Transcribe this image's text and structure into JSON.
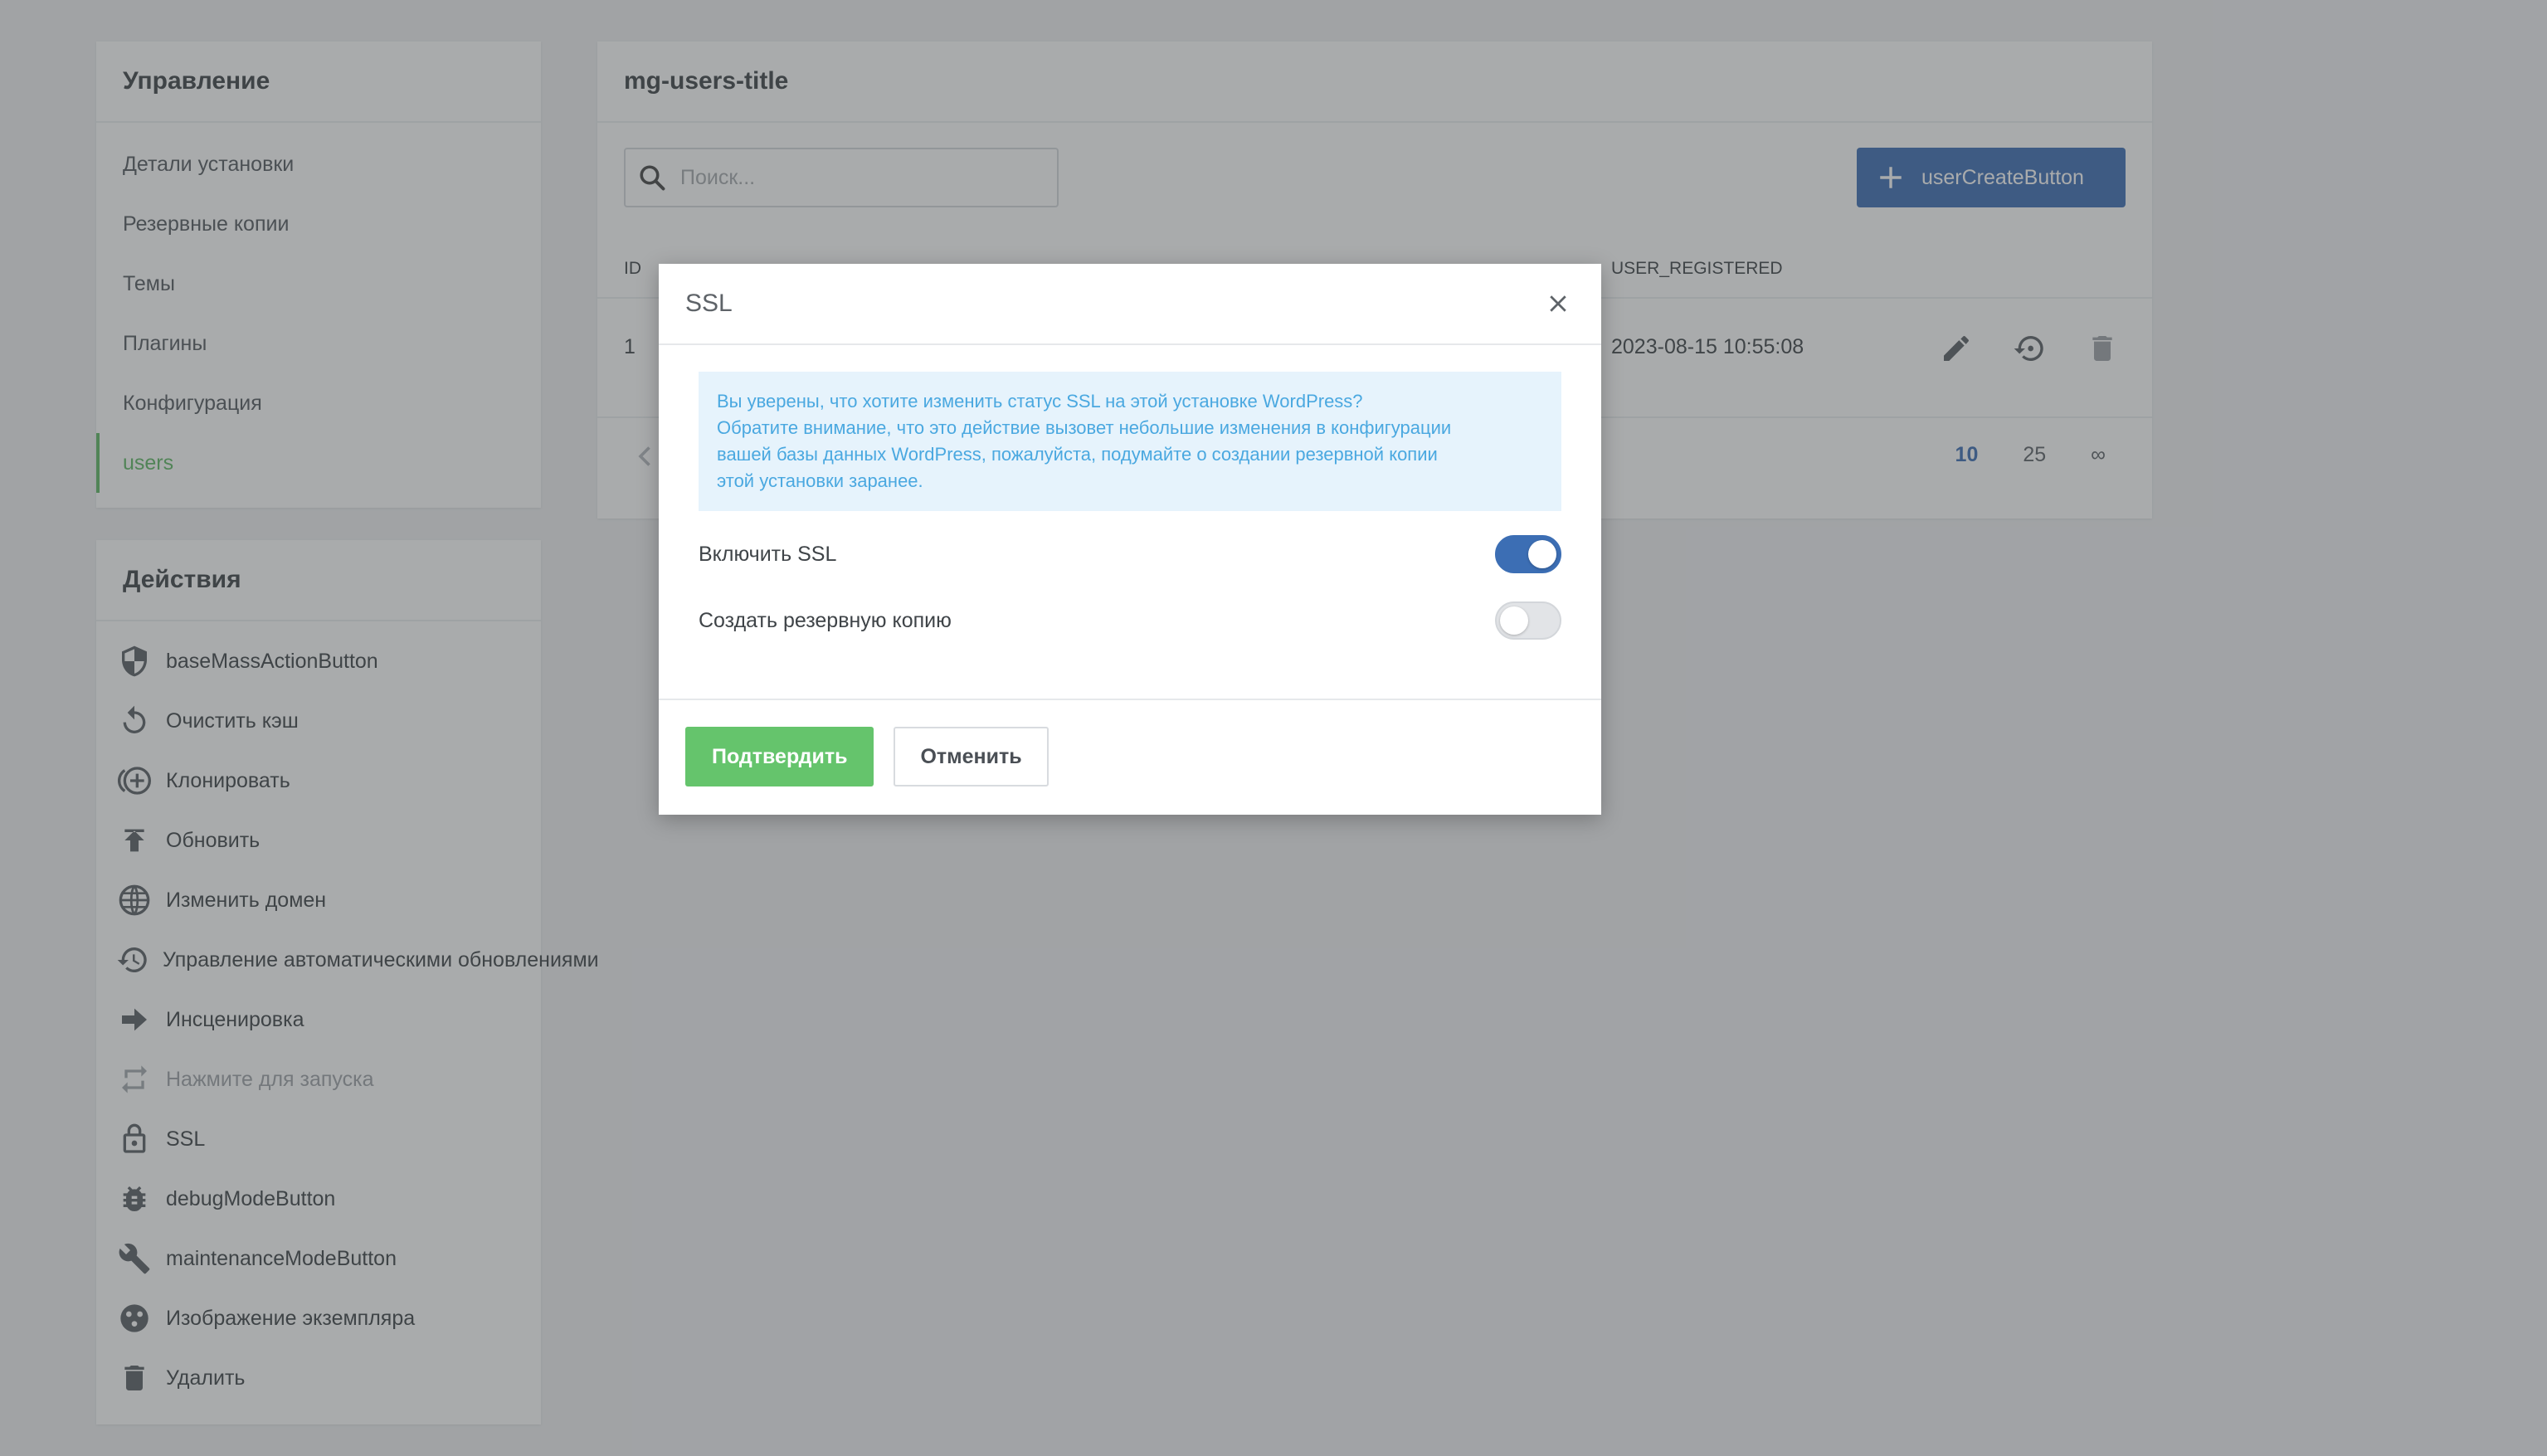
{
  "nav": {
    "title": "Управление",
    "items": [
      {
        "label": "Детали установки",
        "active": false
      },
      {
        "label": "Резервные копии",
        "active": false
      },
      {
        "label": "Темы",
        "active": false
      },
      {
        "label": "Плагины",
        "active": false
      },
      {
        "label": "Конфигурация",
        "active": false
      },
      {
        "label": "users",
        "active": true
      }
    ]
  },
  "actions": {
    "title": "Действия",
    "items": [
      {
        "label": "baseMassActionButton",
        "icon": "shield-icon"
      },
      {
        "label": "Очистить кэш",
        "icon": "refresh-icon"
      },
      {
        "label": "Клонировать",
        "icon": "clone-icon"
      },
      {
        "label": "Обновить",
        "icon": "upload-icon"
      },
      {
        "label": "Изменить домен",
        "icon": "globe-icon"
      },
      {
        "label": "Управление автоматическими обновлениями",
        "icon": "history-icon"
      },
      {
        "label": "Инсценировка",
        "icon": "arrow-right-icon"
      },
      {
        "label": "Нажмите для запуска",
        "icon": "repeat-icon",
        "disabled": true
      },
      {
        "label": "SSL",
        "icon": "lock-icon"
      },
      {
        "label": "debugModeButton",
        "icon": "bug-icon"
      },
      {
        "label": "maintenanceModeButton",
        "icon": "wrench-icon"
      },
      {
        "label": "Изображение экземпляра",
        "icon": "image-icon"
      },
      {
        "label": "Удалить",
        "icon": "trash-icon"
      }
    ]
  },
  "users": {
    "title": "mg-users-title",
    "search_placeholder": "Поиск...",
    "create_button": "userCreateButton",
    "columns": {
      "id": "ID",
      "registered": "USER_REGISTERED"
    },
    "rows": [
      {
        "id": "1",
        "registered": "2023-08-15 10:55:08"
      }
    ],
    "page_sizes": [
      "10",
      "25",
      "∞"
    ],
    "current_page_size": "10"
  },
  "modal": {
    "title": "SSL",
    "alert_lines": [
      "Вы уверены, что хотите изменить статус SSL на этой установке WordPress?",
      "Обратите внимание, что это действие вызовет небольшие изменения в конфигурации",
      "вашей базы данных WordPress, пожалуйста, подумайте о создании резервной копии",
      "этой установки заранее."
    ],
    "enable_ssl_label": "Включить SSL",
    "enable_ssl_on": true,
    "backup_label": "Создать резервную копию",
    "backup_on": false,
    "confirm_label": "Подтвердить",
    "cancel_label": "Отменить"
  },
  "colors": {
    "accent": "#3c6eb4",
    "success": "#65c46c",
    "active_nav": "#5fb865",
    "alert_bg": "#e6f3fc",
    "alert_text": "#4aa8e0"
  }
}
